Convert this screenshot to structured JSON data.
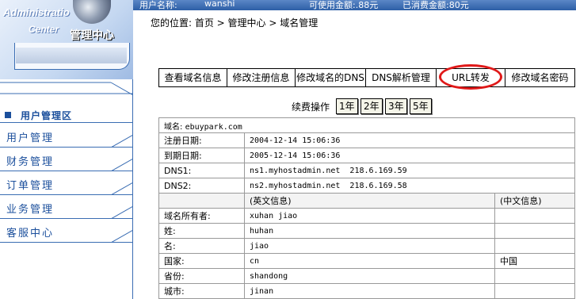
{
  "header": {
    "username_label": "用户名称:",
    "username": "wanshi",
    "available_label": "可使用金额:.88元",
    "spent_label": "已消费金额:80元"
  },
  "logo": {
    "admin": "Administratio",
    "center": "Center",
    "title": "管理中心"
  },
  "sidebar": {
    "section_title": "用户管理区",
    "items": [
      {
        "label": "用户管理"
      },
      {
        "label": "财务管理"
      },
      {
        "label": "订单管理"
      },
      {
        "label": "业务管理"
      },
      {
        "label": "客服中心"
      }
    ]
  },
  "breadcrumb": "您的位置: 首页 > 管理中心 > 域名管理",
  "tabs": [
    {
      "label": "查看域名信息"
    },
    {
      "label": "修改注册信息"
    },
    {
      "label": "修改域名的DNS"
    },
    {
      "label": "DNS解析管理"
    },
    {
      "label": "URL转发",
      "highlighted": true
    },
    {
      "label": "修改域名密码"
    }
  ],
  "renew": {
    "label": "续费操作",
    "options": [
      "1年",
      "2年",
      "3年",
      "5年"
    ]
  },
  "domain_info": {
    "domain_label": "域名:",
    "domain": "ebuypark.com",
    "rows": [
      {
        "label": "注册日期:",
        "value": "2004-12-14 15:06:36"
      },
      {
        "label": "到期日期:",
        "value": "2005-12-14 15:06:36"
      },
      {
        "label": "DNS1:",
        "value": "ns1.myhostadmin.net  218.6.169.59"
      },
      {
        "label": "DNS2:",
        "value": "ns2.myhostadmin.net  218.6.169.58"
      }
    ],
    "col_en": "(英文信息)",
    "col_cn": "(中文信息)",
    "owner_rows": [
      {
        "label": "域名所有者:",
        "en": "xuhan jiao",
        "cn": ""
      },
      {
        "label": "姓:",
        "en": "huhan",
        "cn": ""
      },
      {
        "label": "名:",
        "en": "jiao",
        "cn": ""
      },
      {
        "label": "国家:",
        "en": "cn",
        "cn": "中国"
      },
      {
        "label": "省份:",
        "en": "shandong",
        "cn": ""
      },
      {
        "label": "城市:",
        "en": "jinan",
        "cn": ""
      }
    ]
  },
  "colors": {
    "nav_blue": "#1b4f9c",
    "highlight_ring": "#e01919",
    "header_blue": "#2d5fa6"
  }
}
